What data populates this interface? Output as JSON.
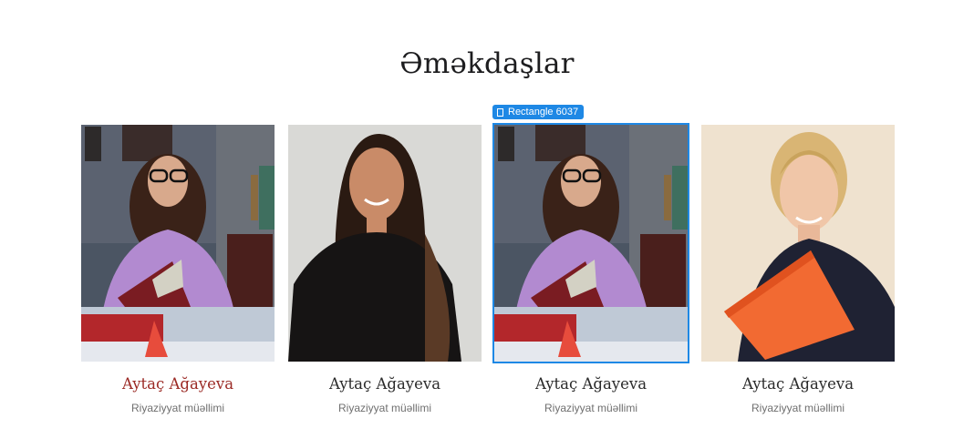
{
  "section": {
    "title": "Əməkdaşlar"
  },
  "selection": {
    "layer_name": "Rectangle 6037",
    "icon": "frame-icon",
    "color": "#1e88e5"
  },
  "staff": [
    {
      "name": "Aytaç Ağayeva",
      "role": "Riyaziyyat müəllimi",
      "photo": "woman-with-glasses-holding-book-photo",
      "name_color": "#9b2a25"
    },
    {
      "name": "Aytaç Ağayeva",
      "role": "Riyaziyyat müəllimi",
      "photo": "woman-with-long-dark-hair-photo",
      "name_color": "#2b2b2b"
    },
    {
      "name": "Aytaç Ağayeva",
      "role": "Riyaziyyat müəllimi",
      "photo": "woman-with-glasses-holding-book-photo",
      "name_color": "#2b2b2b"
    },
    {
      "name": "Aytaç Ağayeva",
      "role": "Riyaziyyat müəllimi",
      "photo": "blonde-woman-with-orange-folder-photo",
      "name_color": "#2b2b2b"
    }
  ]
}
